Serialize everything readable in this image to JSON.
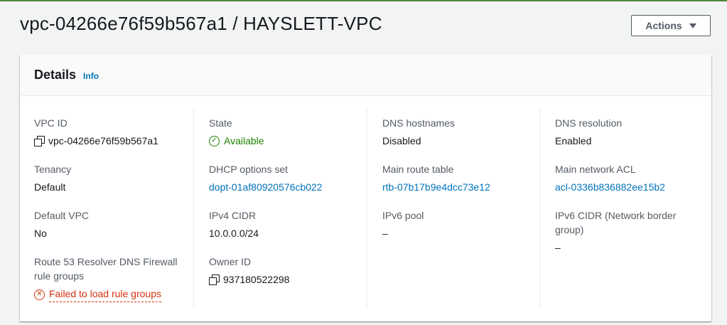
{
  "page": {
    "title": "vpc-04266e76f59b567a1 / HAYSLETT-VPC",
    "actions_label": "Actions"
  },
  "details": {
    "title": "Details",
    "info_label": "Info",
    "vpc_id": {
      "label": "VPC ID",
      "value": "vpc-04266e76f59b567a1"
    },
    "tenancy": {
      "label": "Tenancy",
      "value": "Default"
    },
    "default_vpc": {
      "label": "Default VPC",
      "value": "No"
    },
    "route53": {
      "label": "Route 53 Resolver DNS Firewall rule groups",
      "value": "Failed to load rule groups"
    },
    "state": {
      "label": "State",
      "value": "Available"
    },
    "dhcp": {
      "label": "DHCP options set",
      "value": "dopt-01af80920576cb022"
    },
    "ipv4": {
      "label": "IPv4 CIDR",
      "value": "10.0.0.0/24"
    },
    "owner": {
      "label": "Owner ID",
      "value": "937180522298"
    },
    "dns_hostnames": {
      "label": "DNS hostnames",
      "value": "Disabled"
    },
    "main_route_table": {
      "label": "Main route table",
      "value": "rtb-07b17b9e4dcc73e12"
    },
    "ipv6_pool": {
      "label": "IPv6 pool",
      "value": "–"
    },
    "dns_resolution": {
      "label": "DNS resolution",
      "value": "Enabled"
    },
    "main_acl": {
      "label": "Main network ACL",
      "value": "acl-0336b836882ee15b2"
    },
    "ipv6_cidr": {
      "label": "IPv6 CIDR (Network border group)",
      "value": "–"
    }
  },
  "colors": {
    "link": "#0073bb",
    "success": "#1d8102",
    "error": "#d13212",
    "top_rule": "#4b8a3e"
  },
  "icons": {
    "copy": "copy-icon",
    "state": "check-circle-icon",
    "error": "error-circle-icon",
    "actions": "caret-down-icon"
  }
}
